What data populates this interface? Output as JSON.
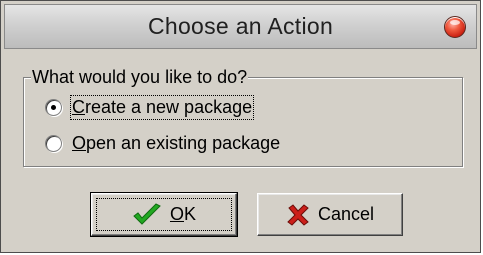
{
  "window": {
    "title": "Choose an Action"
  },
  "group": {
    "legend": "What would you like to do?",
    "options": [
      {
        "label": "Create a new package",
        "mnemonic": "C",
        "rest": "reate a new package",
        "selected": true
      },
      {
        "label": "Open an existing package",
        "mnemonic": "O",
        "rest": "pen an existing package",
        "selected": false
      }
    ]
  },
  "buttons": {
    "ok": {
      "label": "OK",
      "mnemonic": "O",
      "rest": "K",
      "icon": "checkmark-icon",
      "color": "#22a822"
    },
    "cancel": {
      "label": "Cancel",
      "icon": "x-icon",
      "color": "#cc1f1a"
    }
  },
  "colors": {
    "dialog_bg": "#d4d0c8",
    "close_button": "#e0341f"
  }
}
